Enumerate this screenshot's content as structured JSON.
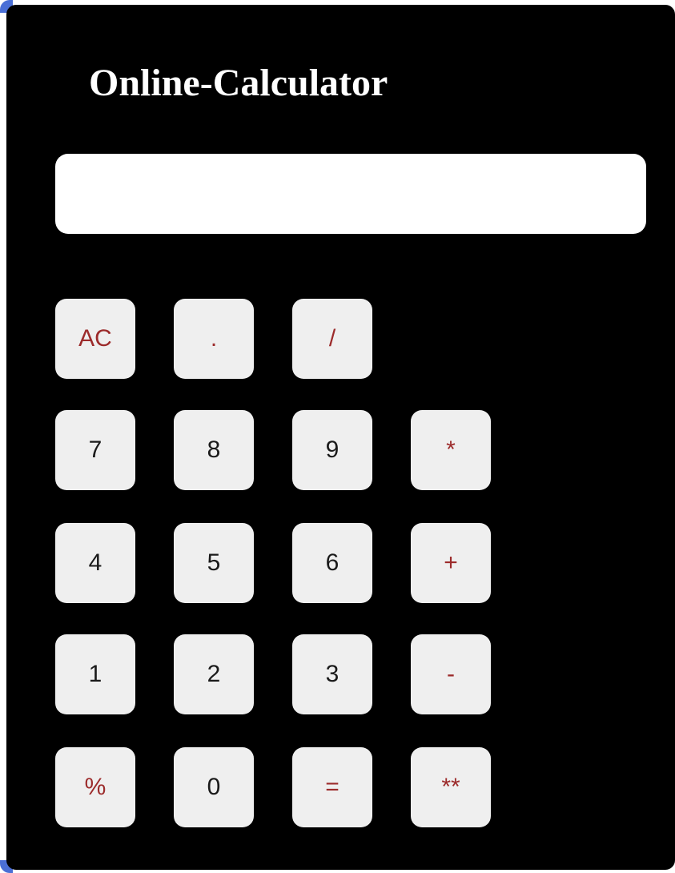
{
  "app": {
    "title": "Online-Calculator"
  },
  "display": {
    "value": ""
  },
  "colors": {
    "background": "#000000",
    "key_background": "#efefef",
    "digit_text": "#1a1a1a",
    "operator_text": "#9c2b2b",
    "display_background": "#ffffff"
  },
  "keys": {
    "clear": "AC",
    "dot": ".",
    "divide": "/",
    "seven": "7",
    "eight": "8",
    "nine": "9",
    "multiply": "*",
    "four": "4",
    "five": "5",
    "six": "6",
    "plus": "+",
    "one": "1",
    "two": "2",
    "three": "3",
    "minus": "-",
    "percent": "%",
    "zero": "0",
    "equals": "=",
    "power": "**"
  }
}
